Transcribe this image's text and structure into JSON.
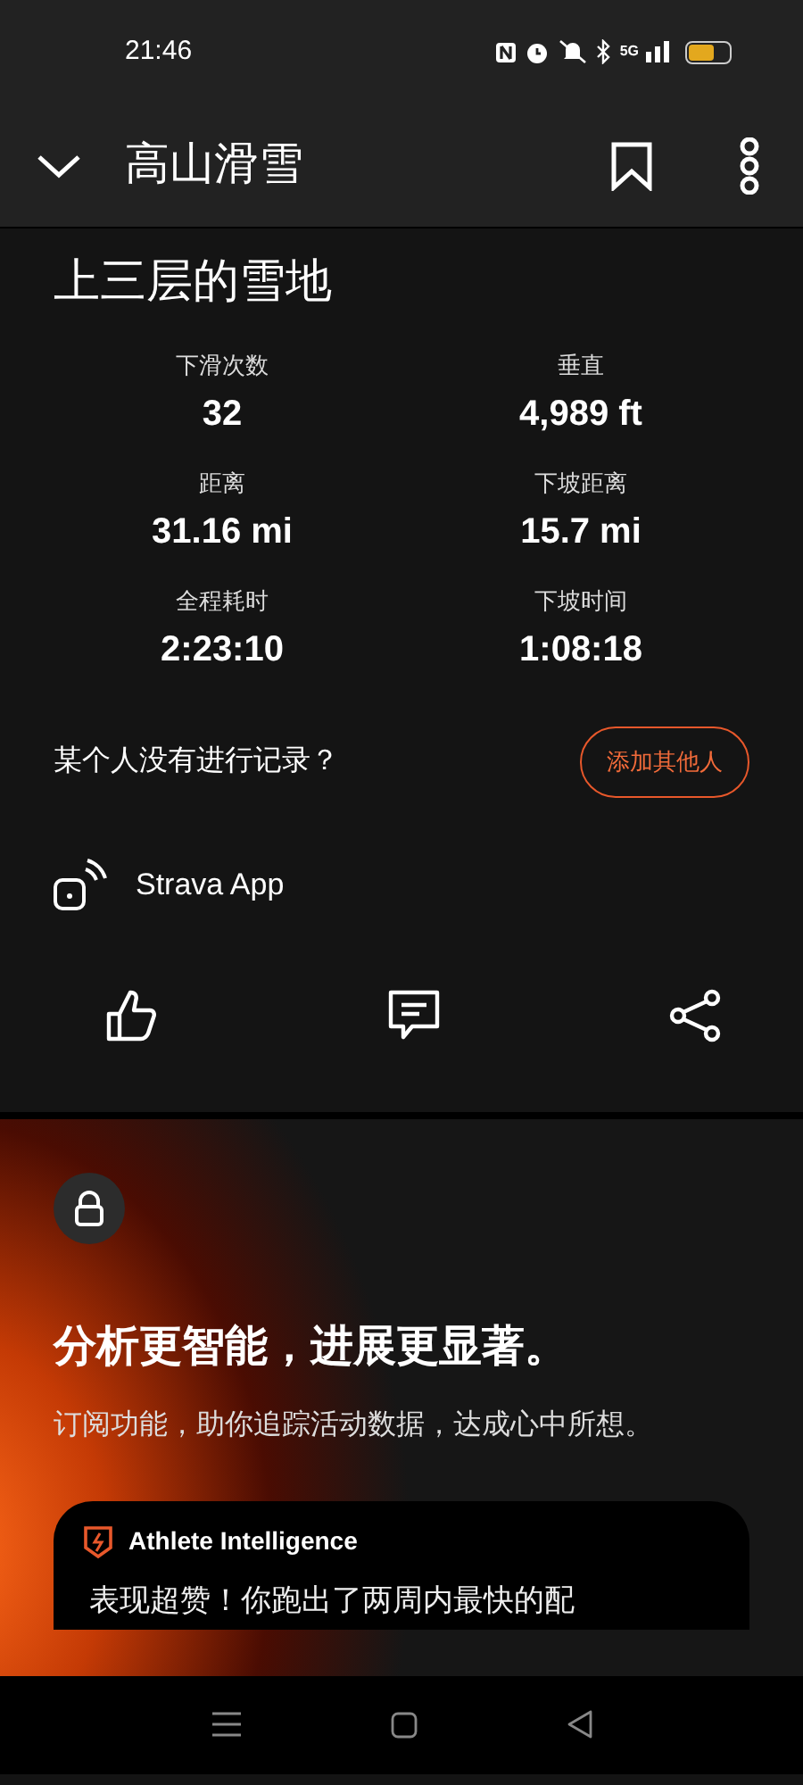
{
  "status_bar": {
    "time": "21:46",
    "network": "5G"
  },
  "header": {
    "title": "高山滑雪"
  },
  "activity": {
    "title": "上三层的雪地",
    "stats": [
      {
        "label": "下滑次数",
        "value": "32"
      },
      {
        "label": "垂直",
        "value": "4,989 ft"
      },
      {
        "label": "距离",
        "value": "31.16 mi"
      },
      {
        "label": "下坡距离",
        "value": "15.7 mi"
      },
      {
        "label": "全程耗时",
        "value": "2:23:10"
      },
      {
        "label": "下坡时间",
        "value": "1:08:18"
      }
    ]
  },
  "add_people": {
    "prompt": "某个人没有进行记录？",
    "button": "添加其他人"
  },
  "device": {
    "name": "Strava App"
  },
  "promo": {
    "headline": "分析更智能，进展更显著。",
    "body": "订阅功能，助你追踪活动数据，达成心中所想。",
    "card": {
      "title": "Athlete Intelligence",
      "text": "表现超赞！你跑出了两周内最快的配"
    }
  }
}
